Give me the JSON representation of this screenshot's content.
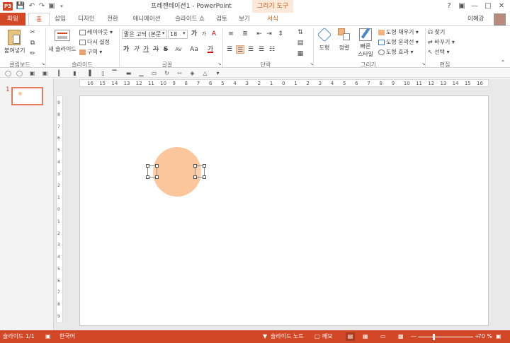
{
  "titlebar": {
    "app_icon": "P3",
    "title": "프레젠테이션1 - PowerPoint",
    "contextual_tab_group": "그리기 도구",
    "help": "?"
  },
  "tabs": [
    "파일",
    "홈",
    "삽입",
    "디자인",
    "전환",
    "애니메이션",
    "슬라이드 쇼",
    "검토",
    "보기",
    "서식"
  ],
  "user": {
    "name": "이혜강"
  },
  "ribbon": {
    "clipboard": {
      "paste": "붙여넣기",
      "label": "클립보드"
    },
    "slides": {
      "new_slide": "새 슬라이드",
      "layout": "레이아웃",
      "reset": "다시 설정",
      "section": "구역",
      "label": "슬라이드"
    },
    "font": {
      "font_name": "맑은 고딕 (본문",
      "font_size": "18",
      "bold": "가",
      "italic": "가",
      "underline": "가",
      "strike": "S",
      "spacing": "AV",
      "case": "Aa",
      "color": "가",
      "grow": "가",
      "shrink": "가",
      "clear": "A",
      "label": "글꼴"
    },
    "paragraph": {
      "label": "단락"
    },
    "drawing": {
      "shapes": "도형",
      "arrange": "정렬",
      "quick_styles_1": "빠른",
      "quick_styles_2": "스타일",
      "fill": "도형 채우기",
      "outline": "도형 윤곽선",
      "effects": "도형 효과",
      "label": "그리기"
    },
    "editing": {
      "find": "찾기",
      "replace": "바꾸기",
      "select": "선택",
      "label": "편집"
    }
  },
  "ruler": {
    "h_ticks": [
      "16",
      "15",
      "14",
      "13",
      "12",
      "11",
      "10",
      "9",
      "8",
      "7",
      "6",
      "5",
      "4",
      "3",
      "2",
      "1",
      "0",
      "1",
      "2",
      "3",
      "4",
      "5",
      "6",
      "7",
      "8",
      "9",
      "10",
      "11",
      "12",
      "13",
      "14",
      "15",
      "16"
    ],
    "v_ticks": [
      "9",
      "8",
      "7",
      "6",
      "5",
      "4",
      "3",
      "2",
      "1",
      "0",
      "1",
      "2",
      "3",
      "4",
      "5",
      "6",
      "7",
      "8",
      "9"
    ]
  },
  "slides_pane": {
    "thumb_number": "1"
  },
  "status": {
    "slide_counter": "슬라이드 1/1",
    "language": "한국어",
    "notes": "슬라이드 노트",
    "comments": "메모",
    "zoom": "70 %",
    "zoom_level_pct": 70
  },
  "colors": {
    "accent": "#d24726",
    "shape_fill": "#fcc69c",
    "context": "#c55a11"
  }
}
